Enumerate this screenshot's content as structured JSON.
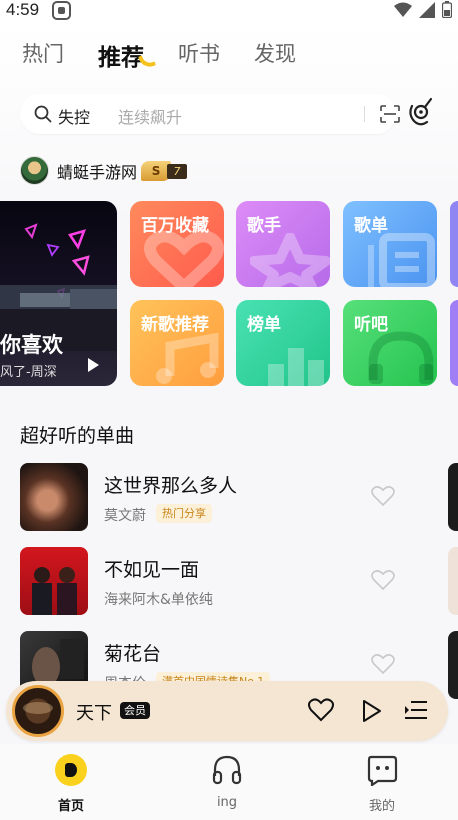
{
  "status_bar": {
    "time": "4:59"
  },
  "tabs": [
    {
      "label": "热门"
    },
    {
      "label": "推荐"
    },
    {
      "label": "听书"
    },
    {
      "label": "发现"
    }
  ],
  "search": {
    "query": "失控",
    "hint": "连续飙升"
  },
  "profile": {
    "name": "蜻蜓手游网",
    "level_letter": "S",
    "level_number": "7"
  },
  "banner": {
    "title": "你喜欢",
    "subtitle": "风了-周深"
  },
  "categories": [
    {
      "label": "百万收藏",
      "color": "#ff6b57"
    },
    {
      "label": "歌手",
      "color": "#c779ee"
    },
    {
      "label": "歌单",
      "color": "#5ea7f6"
    },
    {
      "label": "新歌推荐",
      "color": "#ffab46"
    },
    {
      "label": "榜单",
      "color": "#35d39e"
    },
    {
      "label": "听吧",
      "color": "#34cf5e"
    }
  ],
  "section": {
    "title": "超好听的单曲"
  },
  "songs": [
    {
      "title": "这世界那么多人",
      "artist": "莫文蔚",
      "tag": "热门分享"
    },
    {
      "title": "不如见一面",
      "artist": "海来阿木&单依纯",
      "tag": ""
    },
    {
      "title": "菊花台",
      "artist": "周杰伦",
      "tag": "满首中国情诗集No.1"
    }
  ],
  "player": {
    "title": "天下",
    "badge": "会员",
    "accent": "#e9a441"
  },
  "nav": [
    {
      "label": "首页"
    },
    {
      "label": "ing"
    },
    {
      "label": "我的"
    }
  ],
  "colors": {
    "brand_yellow": "#fad21e",
    "tag_text": "#c7861a"
  }
}
